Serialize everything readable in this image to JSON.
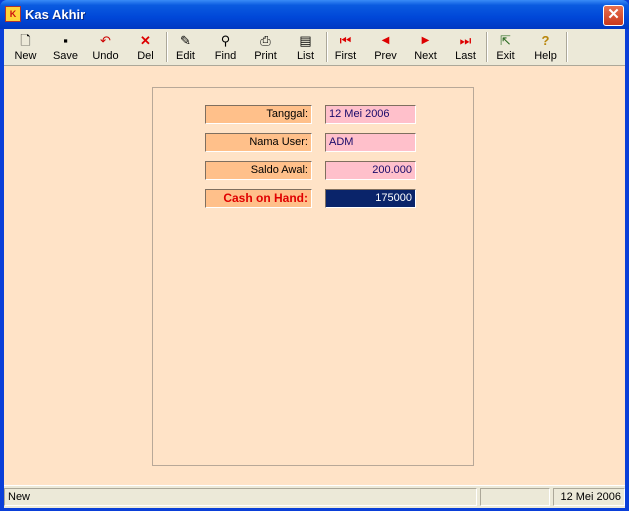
{
  "window": {
    "title": "Kas Akhir",
    "icon": "ks-app-icon",
    "close": "✕"
  },
  "toolbar": {
    "buttons": [
      {
        "label": "New",
        "icon": "new-document-icon",
        "glyph": "🗋"
      },
      {
        "label": "Save",
        "icon": "floppy-disk-icon",
        "glyph": "▪"
      },
      {
        "label": "Undo",
        "icon": "undo-arrow-icon",
        "glyph": "↶"
      },
      {
        "label": "Del",
        "icon": "red-x-icon",
        "glyph": "✕"
      },
      {
        "label": "Edit",
        "icon": "edit-document-icon",
        "glyph": "✎"
      },
      {
        "label": "Find",
        "icon": "binoculars-icon",
        "glyph": "⚲"
      },
      {
        "label": "Print",
        "icon": "printer-icon",
        "glyph": "⎙"
      },
      {
        "label": "List",
        "icon": "list-pages-icon",
        "glyph": "▤"
      },
      {
        "label": "First",
        "icon": "first-record-icon",
        "glyph": "⏮"
      },
      {
        "label": "Prev",
        "icon": "previous-record-icon",
        "glyph": "◀"
      },
      {
        "label": "Next",
        "icon": "next-record-icon",
        "glyph": "▶"
      },
      {
        "label": "Last",
        "icon": "last-record-icon",
        "glyph": "⏭"
      },
      {
        "label": "Exit",
        "icon": "exit-door-icon",
        "glyph": "⇱"
      },
      {
        "label": "Help",
        "icon": "help-question-icon",
        "glyph": "?"
      }
    ]
  },
  "form": {
    "tanggal_label": "Tanggal:",
    "tanggal_value": "12 Mei 2006",
    "user_label": "Nama User:",
    "user_value": "ADM",
    "saldo_label": "Saldo Awal:",
    "saldo_value": "200.000",
    "cash_label": "Cash on Hand:",
    "cash_value": "175000"
  },
  "status": {
    "mode": "New",
    "middle": "",
    "date": "12 Mei 2006"
  },
  "colors": {
    "cash_label_text": "#e00000",
    "cash_value_bg": "#0a246a"
  }
}
